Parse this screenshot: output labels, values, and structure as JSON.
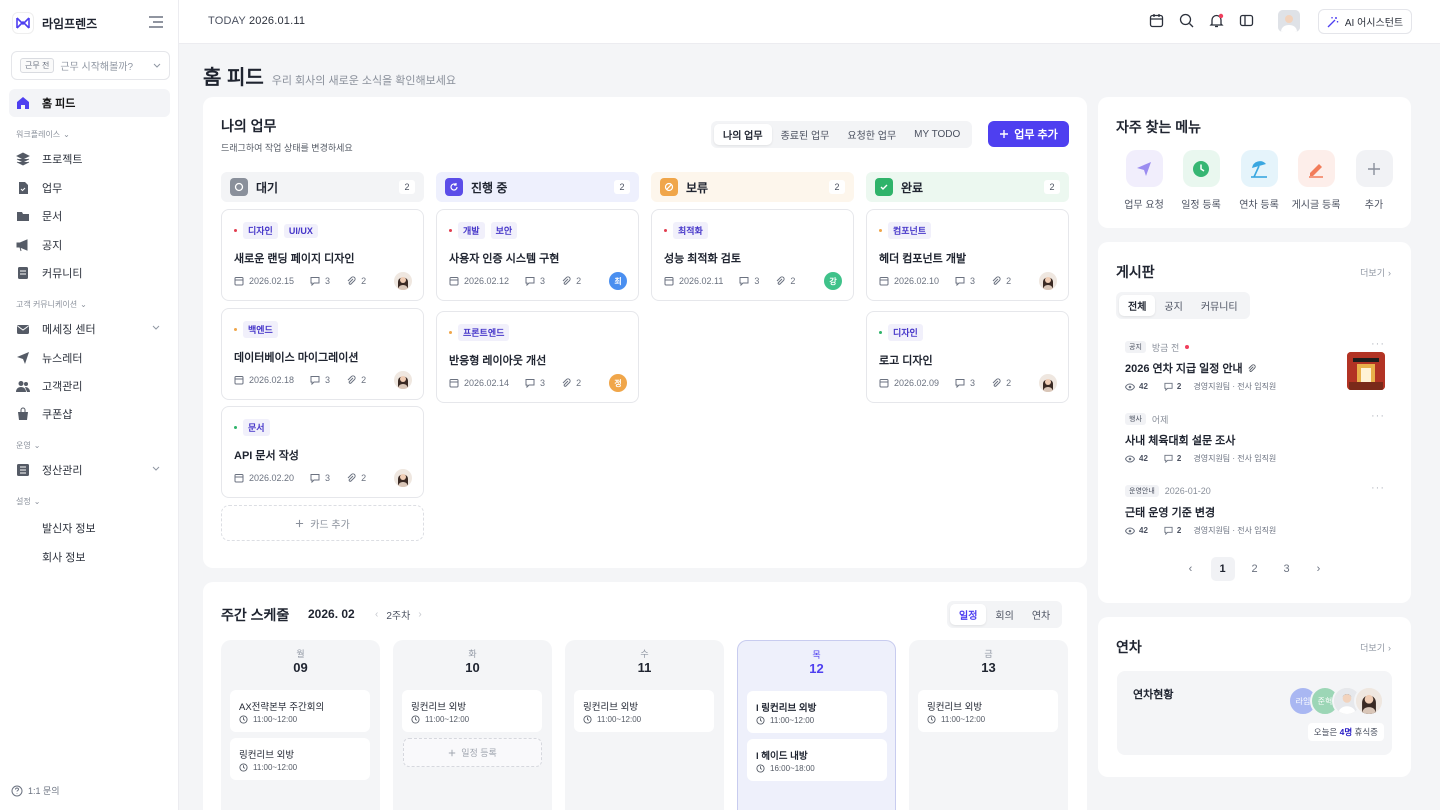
{
  "sidebar": {
    "brand": "라임프렌즈",
    "work_tag": "근무 전",
    "work_prompt": "근무 시작해볼까?",
    "home": "홈 피드",
    "sections": {
      "workplace": "워크플레이스",
      "customer": "고객 커뮤니케이션",
      "operations": "운영",
      "settings": "설정"
    },
    "workplace_items": [
      "프로젝트",
      "업무",
      "문서",
      "공지",
      "커뮤니티"
    ],
    "customer_items": [
      "메세징 센터",
      "뉴스레터",
      "고객관리",
      "쿠폰샵"
    ],
    "operations_items": [
      "정산관리"
    ],
    "settings_items": [
      "발신자 정보",
      "회사 정보"
    ],
    "inquiry": "1:1 문의"
  },
  "topbar": {
    "today_label": "TODAY",
    "today_date": "2026.01.11",
    "ai_button": "AI 어시스턴트",
    "icons": [
      "calendar-icon",
      "search-icon",
      "bell-icon",
      "message-icon"
    ]
  },
  "page": {
    "title": "홈 피드",
    "subtitle": "우리 회사의 새로운 소식을 확인해보세요"
  },
  "mywork": {
    "title": "나의 업무",
    "subtitle": "드래그하여 작업 상태를 변경하세요",
    "tabs": [
      "나의 업무",
      "종료된 업무",
      "요청한 업무",
      "MY TODO"
    ],
    "add_button": "업무 추가",
    "add_card": "카드 추가",
    "columns": [
      {
        "name": "대기",
        "count": "2",
        "cards": [
          {
            "tags": [
              "디자인",
              "UI/UX"
            ],
            "title": "새로운 랜딩 페이지 디자인",
            "date": "2026.02.15",
            "comments": "3",
            "files": "2"
          },
          {
            "tags": [
              "백엔드"
            ],
            "title": "데이터베이스 마이그레이션",
            "date": "2026.02.18",
            "comments": "3",
            "files": "2"
          },
          {
            "tags": [
              "문서"
            ],
            "title": "API 문서 작성",
            "date": "2026.02.20",
            "comments": "3",
            "files": "2"
          }
        ]
      },
      {
        "name": "진행 중",
        "count": "2",
        "cards": [
          {
            "tags": [
              "개발",
              "보안"
            ],
            "title": "사용자 인증 시스템 구현",
            "date": "2026.02.12",
            "comments": "3",
            "files": "2",
            "avatar": "최"
          },
          {
            "tags": [
              "프론트엔드"
            ],
            "title": "반응형 레이아웃 개선",
            "date": "2026.02.14",
            "comments": "3",
            "files": "2",
            "avatar": "정"
          }
        ]
      },
      {
        "name": "보류",
        "count": "2",
        "cards": [
          {
            "tags": [
              "최적화"
            ],
            "title": "성능 최적화 검토",
            "date": "2026.02.11",
            "comments": "3",
            "files": "2",
            "avatar": "강"
          }
        ]
      },
      {
        "name": "완료",
        "count": "2",
        "cards": [
          {
            "tags": [
              "컴포넌트"
            ],
            "title": "헤더 컴포넌트 개발",
            "date": "2026.02.10",
            "comments": "3",
            "files": "2"
          },
          {
            "tags": [
              "디자인"
            ],
            "title": "로고 디자인",
            "date": "2026.02.09",
            "comments": "3",
            "files": "2"
          }
        ]
      }
    ]
  },
  "weekly": {
    "title": "주간 스케줄",
    "month": "2026. 02",
    "week": "2주차",
    "tabs": [
      "일정",
      "회의",
      "연차"
    ],
    "add_event": "일정 등록",
    "days": [
      {
        "weekday": "월",
        "day": "09",
        "events": [
          {
            "title": "AX전략본부 주간회의",
            "time": "11:00~12:00"
          },
          {
            "title": "링컨리브 외방",
            "time": "11:00~12:00"
          }
        ]
      },
      {
        "weekday": "화",
        "day": "10",
        "events": [
          {
            "title": "링컨리브 외방",
            "time": "11:00~12:00"
          }
        ]
      },
      {
        "weekday": "수",
        "day": "11",
        "events": [
          {
            "title": "링컨리브 외방",
            "time": "11:00~12:00"
          }
        ]
      },
      {
        "weekday": "목",
        "day": "12",
        "events": [
          {
            "title": "l 링컨리브 외방",
            "time": "11:00~12:00"
          },
          {
            "title": "l 헤이드 내방",
            "time": "16:00~18:00"
          }
        ]
      },
      {
        "weekday": "금",
        "day": "13",
        "events": [
          {
            "title": "링컨리브 외방",
            "time": "11:00~12:00"
          }
        ]
      }
    ]
  },
  "quick": {
    "title": "자주 찾는 메뉴",
    "items": [
      "업무 요청",
      "일정 등록",
      "연차 등록",
      "게시글 등록",
      "추가"
    ]
  },
  "board": {
    "title": "게시판",
    "more": "더보기",
    "tabs": [
      "전체",
      "공지",
      "커뮤니티"
    ],
    "posts": [
      {
        "badge": "공지",
        "when": "방금 전",
        "title": "2026 연차 지급 일정 안내",
        "views": "42",
        "comments": "2",
        "org": "경영지원팀 · 전사 임직원"
      },
      {
        "badge": "행사",
        "when": "어제",
        "title": "사내 체육대회 설문 조사",
        "views": "42",
        "comments": "2",
        "org": "경영지원팀 · 전사 임직원"
      },
      {
        "badge": "운영안내",
        "when": "2026-01-20",
        "title": "근태 운영 기준 변경",
        "views": "42",
        "comments": "2",
        "org": "경영지원팀 · 전사 임직원"
      }
    ],
    "pages": [
      "1",
      "2",
      "3"
    ]
  },
  "leave": {
    "title": "연차",
    "more": "더보기",
    "status": "연차현황",
    "avatars": [
      "라임",
      "준혁"
    ],
    "today_prefix": "오늘은",
    "today_count": "4명",
    "today_suffix": "휴식중"
  },
  "colors": {
    "primary": "#4e3ff0",
    "waiting": "#8a909b",
    "progress": "#5b4de8",
    "hold": "#f0a64a",
    "done": "#2fb36a"
  }
}
